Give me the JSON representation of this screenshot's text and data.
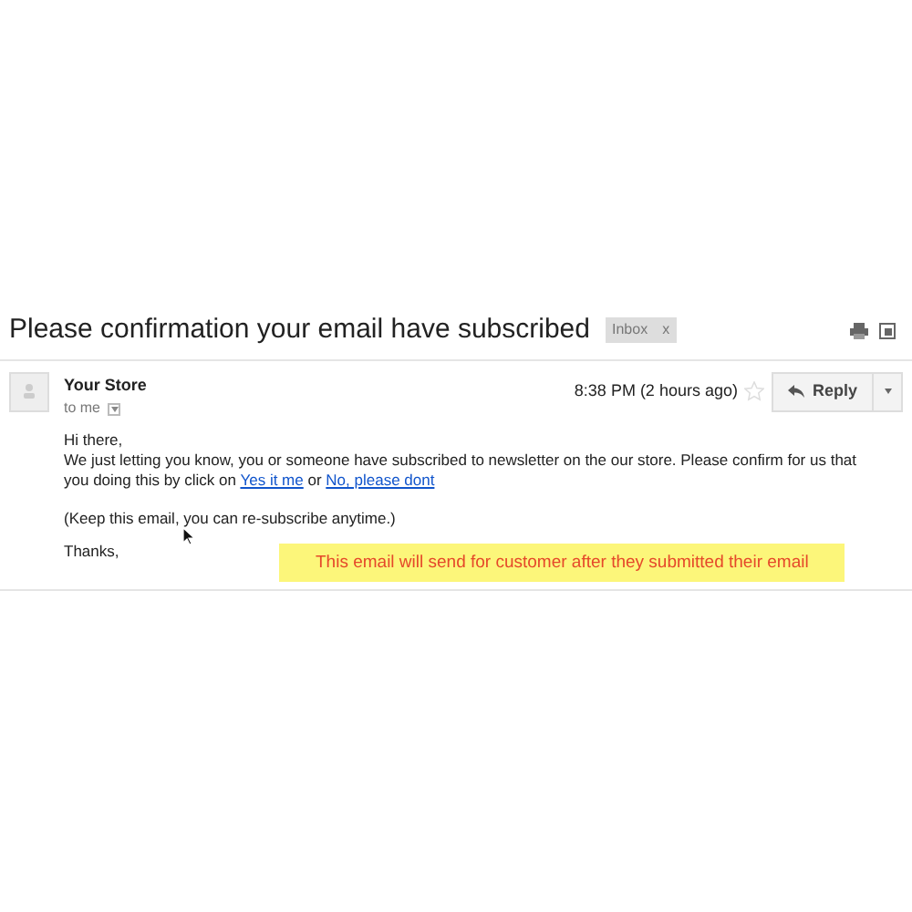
{
  "subject": "Please confirmation your email have subscribed",
  "label": {
    "text": "Inbox",
    "remove": "x"
  },
  "sender": {
    "name": "Your Store",
    "to": "to me",
    "time": "8:38 PM (2 hours ago)",
    "starred": false
  },
  "reply_button": "Reply",
  "body": {
    "greeting": "Hi there,",
    "text": "We just letting you know, you or someone have subscribed to newsletter on the our store. Please confirm for us that you doing this by click on ",
    "link_1": "Yes it me",
    "between": " or ",
    "link_2": "No, please dont",
    "note": "(Keep this email, you can re-subscribe anytime.)",
    "closing": "Thanks,"
  },
  "callout": "This email will send for customer after they submitted their email"
}
